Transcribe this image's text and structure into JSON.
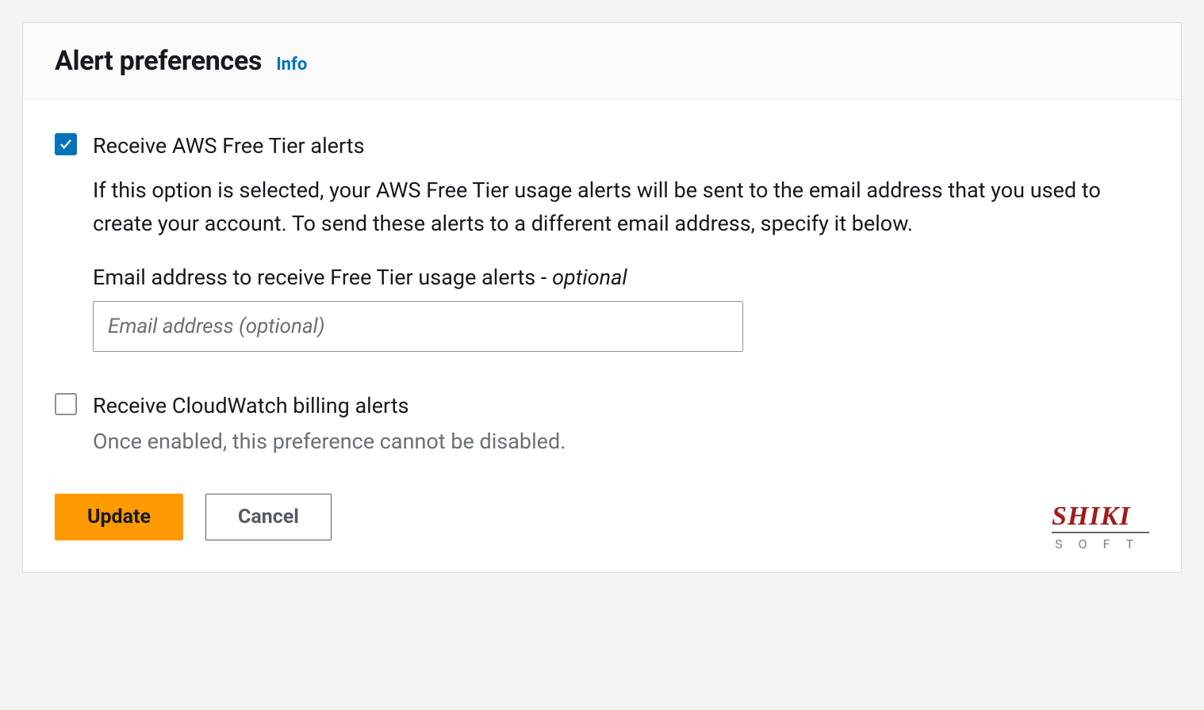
{
  "header": {
    "title": "Alert preferences",
    "info_label": "Info"
  },
  "free_tier": {
    "checked": true,
    "label": "Receive AWS Free Tier alerts",
    "description": "If this option is selected, your AWS Free Tier usage alerts will be sent to the email address that you used to create your account. To send these alerts to a different email address, specify it below.",
    "email_label_main": "Email address to receive Free Tier usage alerts - ",
    "email_label_optional": "optional",
    "email_placeholder": "Email address (optional)",
    "email_value": ""
  },
  "cloudwatch": {
    "checked": false,
    "label": "Receive CloudWatch billing alerts",
    "help": "Once enabled, this preference cannot be disabled."
  },
  "buttons": {
    "update": "Update",
    "cancel": "Cancel"
  },
  "watermark": {
    "brand": "SHIKI",
    "sub": "SOFT"
  }
}
